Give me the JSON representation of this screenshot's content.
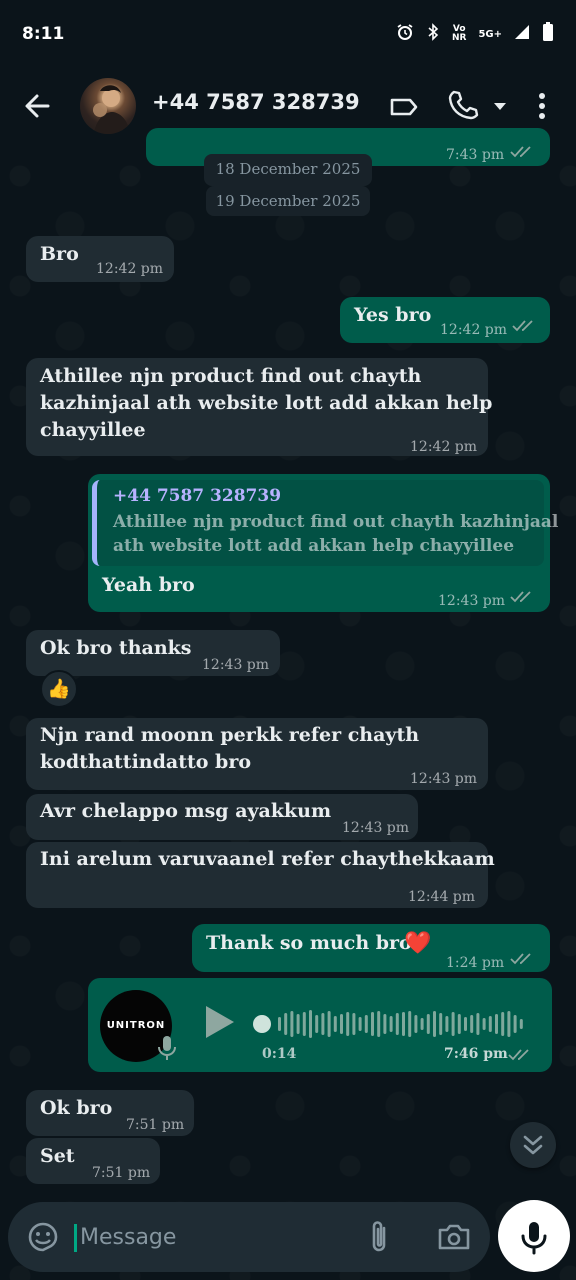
{
  "status_bar": {
    "time": "8:11",
    "net_top": "Vo",
    "net_bottom": "NR",
    "net_type": "5G+"
  },
  "header": {
    "contact": "+44 7587 328739"
  },
  "dates": {
    "first": "18 December 2025",
    "second": "19 December 2025"
  },
  "messages": {
    "partial_time": "7:43 pm",
    "m1": {
      "text": "Bro",
      "time": "12:42 pm"
    },
    "m2": {
      "text": "Yes bro",
      "time": "12:42 pm"
    },
    "m3": {
      "line1": "Athillee njn product find out chayth",
      "line2": "kazhinjaal ath website lott add akkan help",
      "line3": "chayyillee",
      "time": "12:42 pm"
    },
    "m4": {
      "quote_author": "+44 7587 328739",
      "quote_line1": "Athillee njn product find out chayth kazhinjaal",
      "quote_line2": "ath website lott add akkan help chayyillee",
      "text": "Yeah bro",
      "time": "12:43 pm"
    },
    "m5": {
      "text": "Ok bro thanks",
      "time": "12:43 pm",
      "reaction": "👍"
    },
    "m6": {
      "line1": "Njn rand moonn perkk refer chayth",
      "line2": "kodthattindatto bro",
      "time": "12:43 pm"
    },
    "m7": {
      "text": "Avr chelappo msg ayakkum",
      "time": "12:43 pm"
    },
    "m8": {
      "text": "Ini arelum varuvaanel refer chaythekkaam",
      "time": "12:44 pm"
    },
    "m9": {
      "text": "Thank so much bro",
      "emoji": "❤️",
      "time": "1:24 pm"
    },
    "voice": {
      "avatar_text": "UNITRON",
      "duration": "0:14",
      "time": "7:46 pm"
    },
    "m10": {
      "text": "Ok bro",
      "time": "7:51 pm"
    },
    "m11": {
      "text": "Set",
      "time": "7:51 pm"
    }
  },
  "input": {
    "placeholder": "Message"
  },
  "colors": {
    "background": "#0b141a",
    "incoming": "#202c33",
    "outgoing": "#005c4b",
    "accent": "#00a884",
    "read_ticks": "#8ea7a0"
  }
}
